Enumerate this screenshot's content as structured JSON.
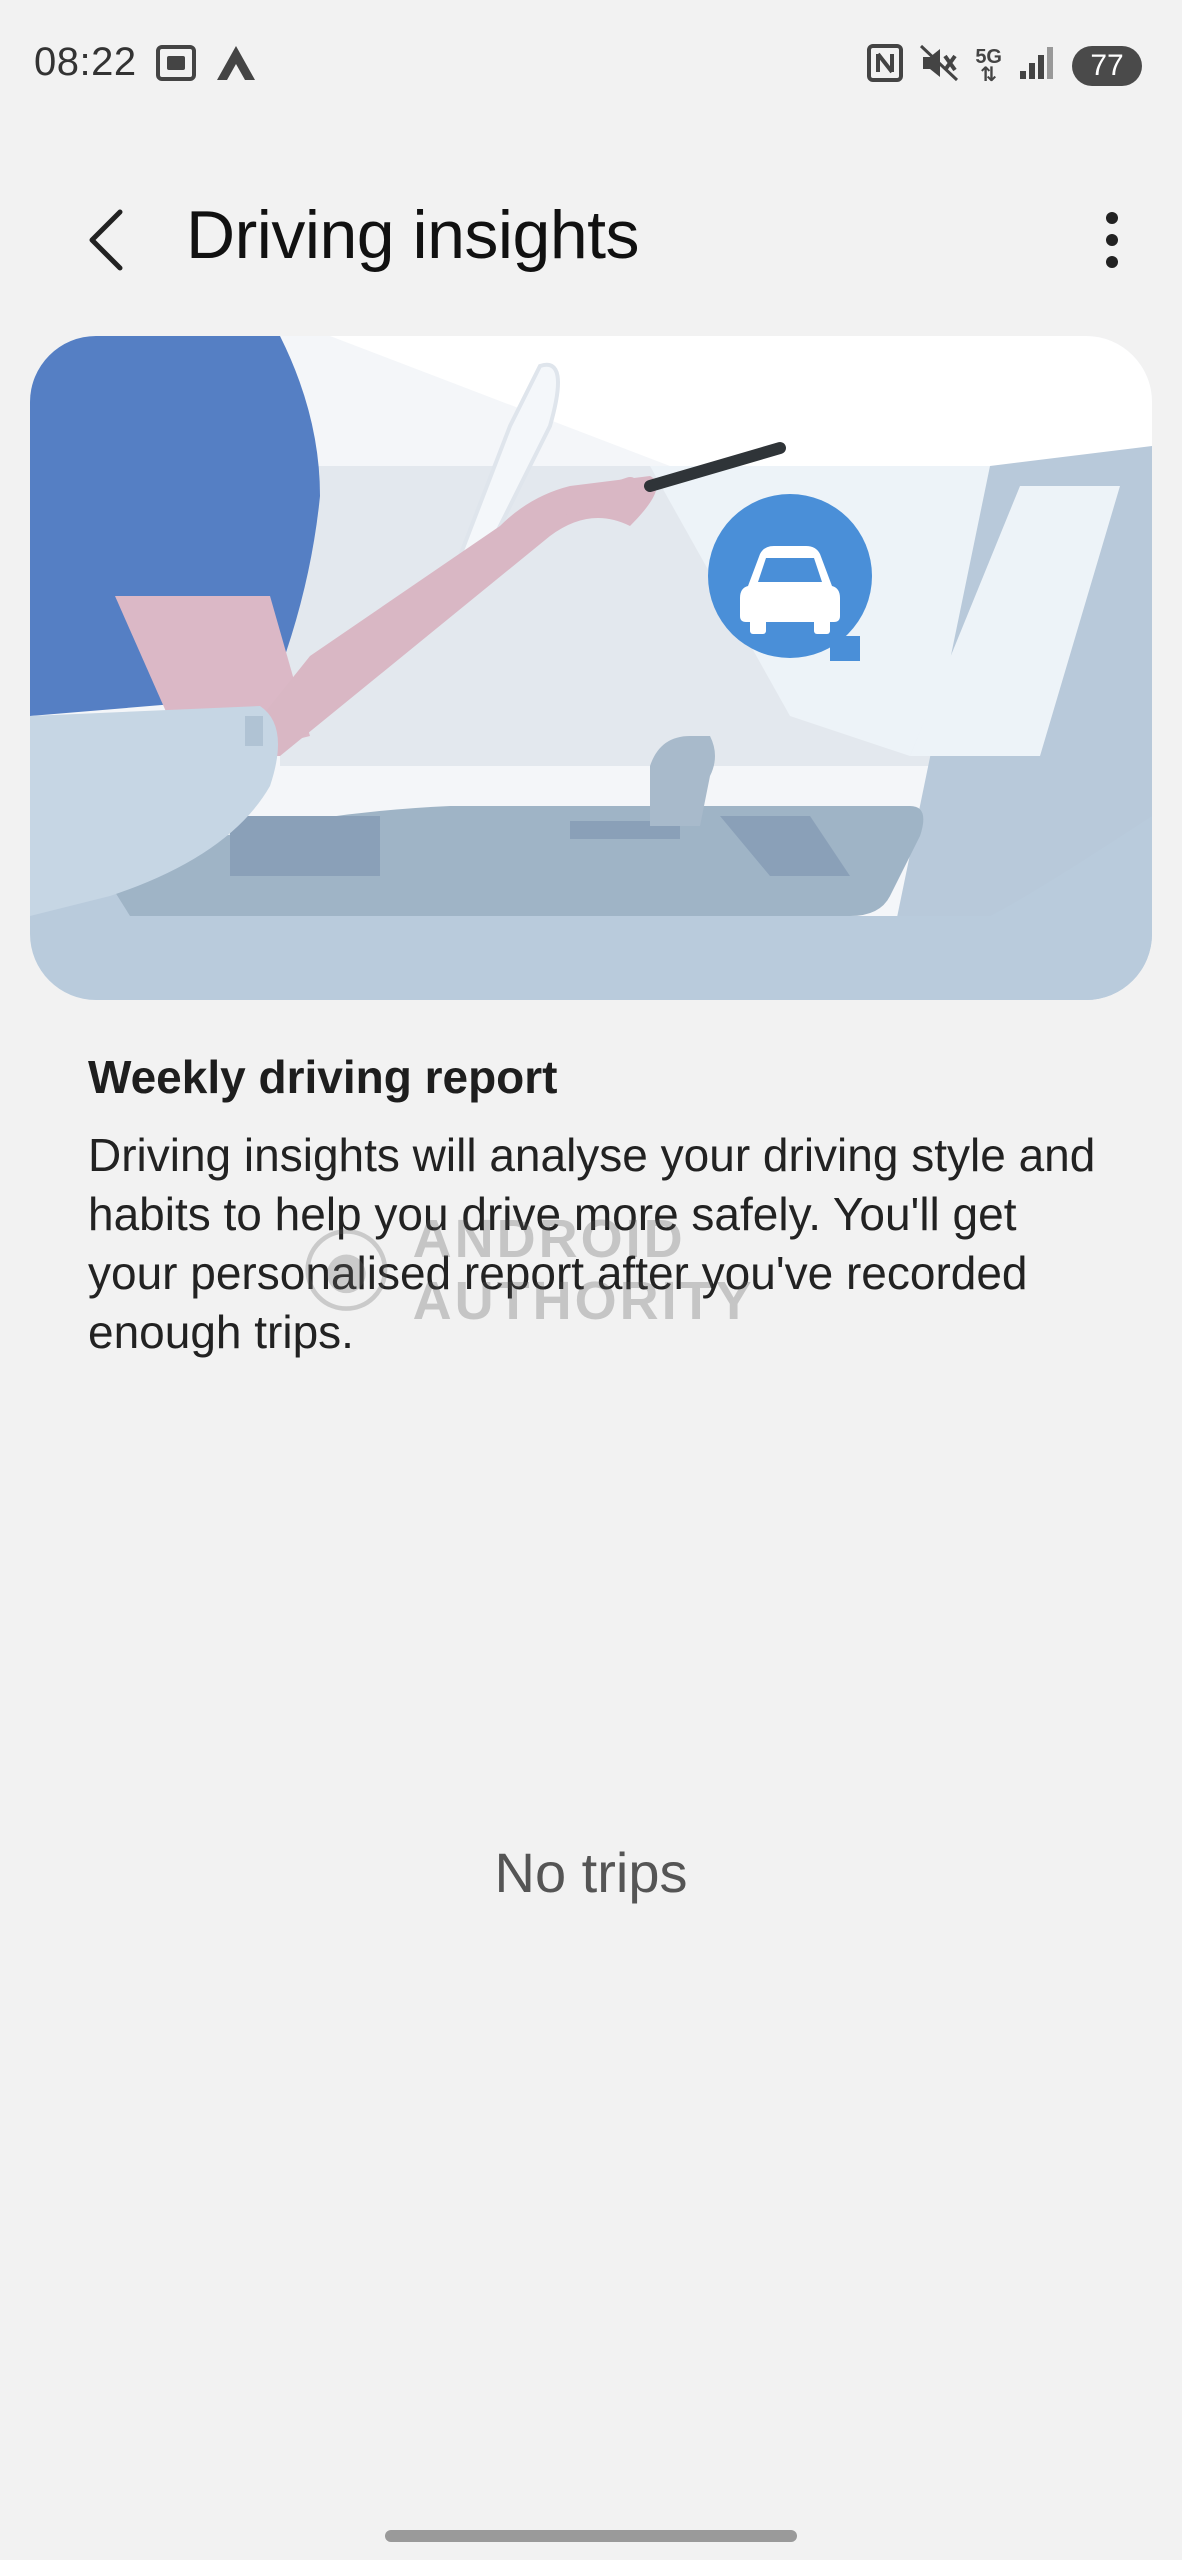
{
  "status_bar": {
    "time": "08:22",
    "battery": "77",
    "network": "5G",
    "left_icons": [
      "screenshot-icon",
      "android-auto-icon"
    ],
    "right_icons": [
      "nfc-icon",
      "mute-icon",
      "5g-icon",
      "signal-icon",
      "battery-icon"
    ]
  },
  "app_bar": {
    "title": "Driving insights",
    "back_icon": "chevron-left-icon",
    "more_icon": "more-vert-icon"
  },
  "hero": {
    "icon": "car-icon",
    "accent_color": "#4a8fd8"
  },
  "report": {
    "title": "Weekly driving report",
    "description": "Driving insights will analyse your driving style and habits to help you drive more safely. You'll get your personalised report after you've recorded enough trips."
  },
  "watermark": {
    "text": "ANDROID AUTHORITY"
  },
  "empty_state": {
    "label": "No trips"
  }
}
